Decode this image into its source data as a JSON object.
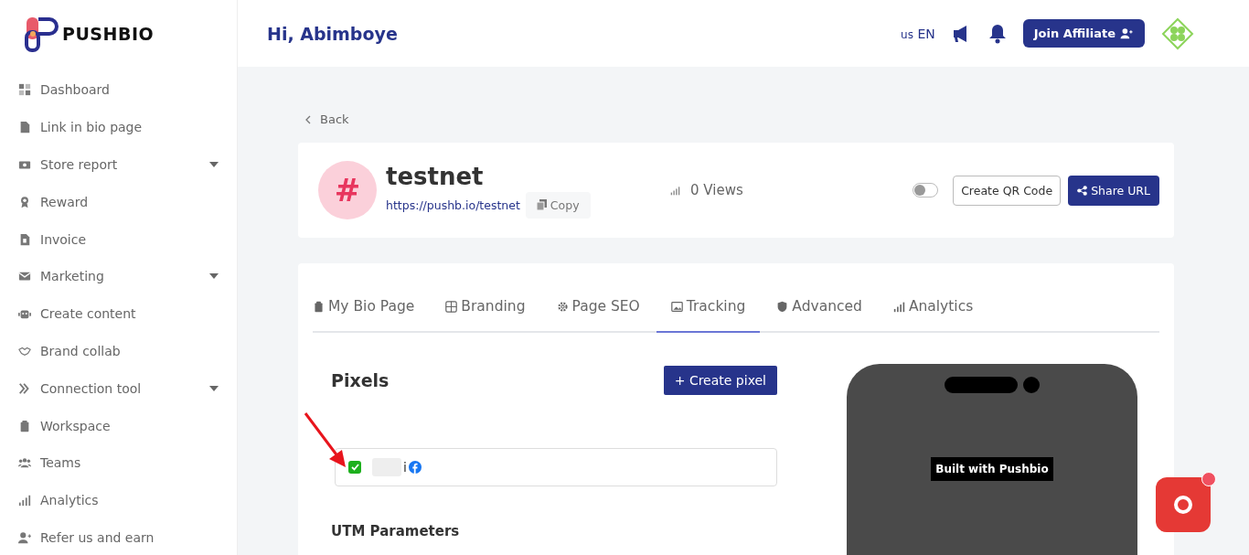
{
  "brand": {
    "name": "PUSHBIO"
  },
  "sidebar": {
    "items": [
      {
        "label": "Dashboard",
        "expandable": false
      },
      {
        "label": "Link in bio page",
        "expandable": false
      },
      {
        "label": "Store report",
        "expandable": true
      },
      {
        "label": "Reward",
        "expandable": false
      },
      {
        "label": "Invoice",
        "expandable": false
      },
      {
        "label": "Marketing",
        "expandable": true
      },
      {
        "label": "Create content",
        "expandable": false
      },
      {
        "label": "Brand collab",
        "expandable": false
      },
      {
        "label": "Connection tool",
        "expandable": true
      },
      {
        "label": "Workspace",
        "expandable": false
      },
      {
        "label": "Teams",
        "expandable": false
      },
      {
        "label": "Analytics",
        "expandable": false
      },
      {
        "label": "Refer us and earn",
        "expandable": false
      }
    ]
  },
  "header": {
    "greeting": "Hi, Abimboye",
    "language_flag": "us",
    "language": "EN",
    "affiliate_button": "Join Affiliate"
  },
  "back_link": "Back",
  "page": {
    "avatar_symbol": "#",
    "name": "testnet",
    "url": "https://pushb.io/testnet",
    "copy_button": "Copy",
    "views": "0 Views",
    "enabled": false,
    "qr_button": "Create QR Code",
    "share_button": "Share URL"
  },
  "tabs": [
    {
      "label": "My Bio Page",
      "selected": false
    },
    {
      "label": "Branding",
      "selected": false
    },
    {
      "label": "Page SEO",
      "selected": false
    },
    {
      "label": "Tracking",
      "selected": true
    },
    {
      "label": "Advanced",
      "selected": false
    },
    {
      "label": "Analytics",
      "selected": false
    }
  ],
  "pixels": {
    "title": "Pixels",
    "create_button": "+  Create pixel",
    "items": [
      {
        "name": "i",
        "active": true
      }
    ]
  },
  "utm": {
    "title": "UTM Parameters"
  },
  "preview": {
    "badge": "Built with Pushbio"
  }
}
